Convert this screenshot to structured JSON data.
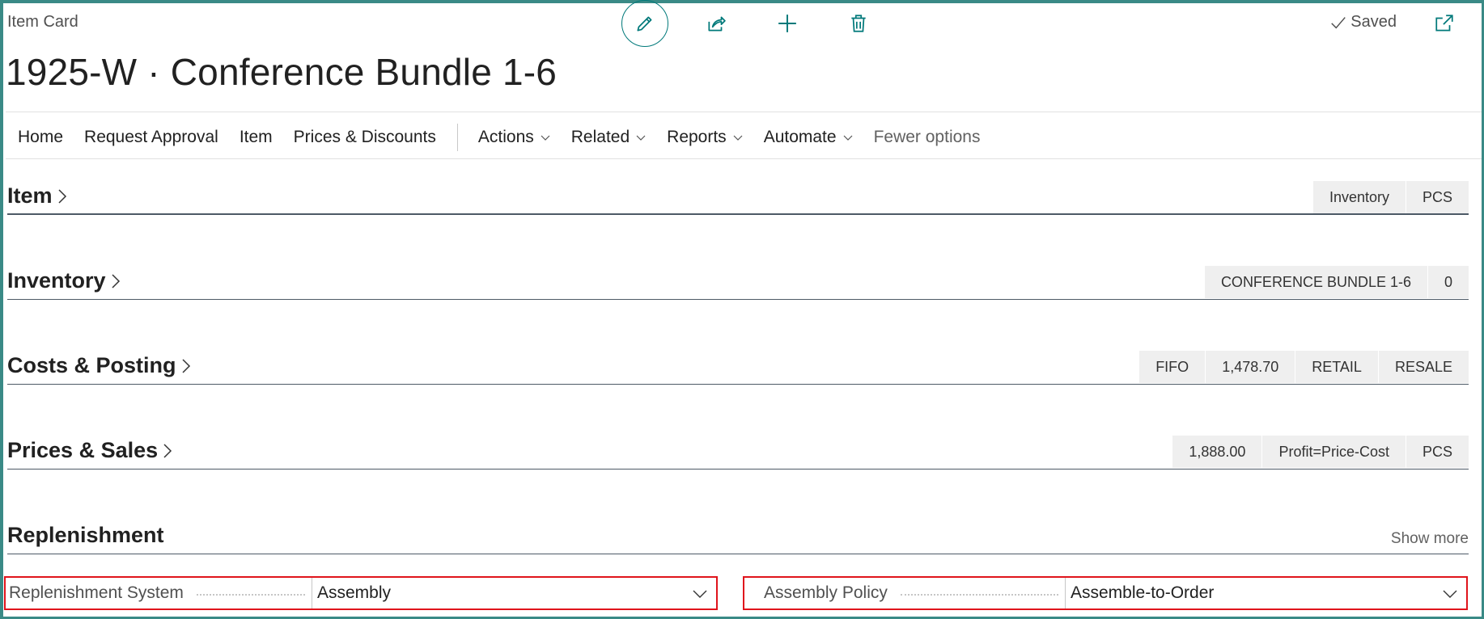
{
  "header": {
    "caption": "Item Card",
    "title": "1925-W · Conference Bundle 1-6",
    "saved_label": "Saved"
  },
  "toolbar": {
    "icons": [
      "pencil-icon",
      "share-icon",
      "plus-icon",
      "trash-icon",
      "popout-icon"
    ]
  },
  "menu": {
    "items": [
      "Home",
      "Request Approval",
      "Item",
      "Prices & Discounts"
    ],
    "dropdowns": [
      "Actions",
      "Related",
      "Reports",
      "Automate"
    ],
    "fewer_options": "Fewer options"
  },
  "sections": {
    "item": {
      "title": "Item",
      "pills": [
        "Inventory",
        "PCS"
      ]
    },
    "inventory": {
      "title": "Inventory",
      "pills": [
        "CONFERENCE BUNDLE 1-6",
        "0"
      ]
    },
    "costs": {
      "title": "Costs & Posting",
      "pills": [
        "FIFO",
        "1,478.70",
        "RETAIL",
        "RESALE"
      ]
    },
    "prices": {
      "title": "Prices & Sales",
      "pills": [
        "1,888.00",
        "Profit=Price-Cost",
        "PCS"
      ]
    },
    "replenishment": {
      "title": "Replenishment",
      "show_more": "Show more"
    }
  },
  "fields": {
    "replenishment_system": {
      "label": "Replenishment System",
      "value": "Assembly"
    },
    "assembly_policy": {
      "label": "Assembly Policy",
      "value": "Assemble-to-Order"
    }
  },
  "colors": {
    "accent": "#00797a",
    "frame": "#3a8a86",
    "highlight": "#e0141c"
  }
}
